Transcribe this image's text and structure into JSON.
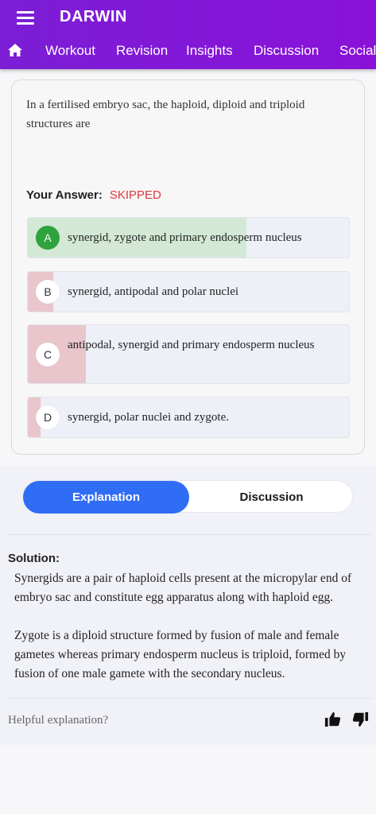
{
  "app": {
    "title": "DARWIN"
  },
  "nav": {
    "tabs": [
      {
        "label": "Workout"
      },
      {
        "label": "Revision"
      },
      {
        "label": "Insights"
      },
      {
        "label": "Discussion"
      },
      {
        "label": "Social"
      }
    ]
  },
  "question": {
    "text": "In a fertilised embryo sac, the haploid, diploid and triploid structures are",
    "answer_label": "Your Answer:",
    "answer_value": "SKIPPED",
    "options": [
      {
        "letter": "A",
        "text": "synergid, zygote and primary endosperm nucleus",
        "correct": true,
        "response_fraction": 0.68
      },
      {
        "letter": "B",
        "text": "synergid, antipodal and polar nuclei",
        "correct": false,
        "response_fraction": 0.08
      },
      {
        "letter": "C",
        "text": "antipodal, synergid and primary endosperm nucleus",
        "correct": false,
        "response_fraction": 0.18
      },
      {
        "letter": "D",
        "text": "synergid, polar nuclei and zygote.",
        "correct": false,
        "response_fraction": 0.04
      }
    ]
  },
  "toggle": {
    "explanation": "Explanation",
    "discussion": "Discussion",
    "active": "explanation"
  },
  "solution": {
    "title": "Solution:",
    "paragraphs": [
      "Synergids are a pair of haploid cells present at the micropylar end of embryo sac and constitute egg apparatus along with haploid egg.",
      "Zygote is a diploid structure formed by fusion of male and female gametes whereas primary endosperm nucleus is triploid, formed by fusion of one male gamete with the secondary nucleus."
    ]
  },
  "feedback": {
    "prompt": "Helpful explanation?"
  },
  "colors": {
    "header": "#7b1ed6",
    "accent_blue": "#2f6df5",
    "correct_fill": "#d3e9d6",
    "wrong_fill": "#e8c6cc",
    "correct_badge": "#2ea33e",
    "skipped_text": "#e0383e"
  }
}
